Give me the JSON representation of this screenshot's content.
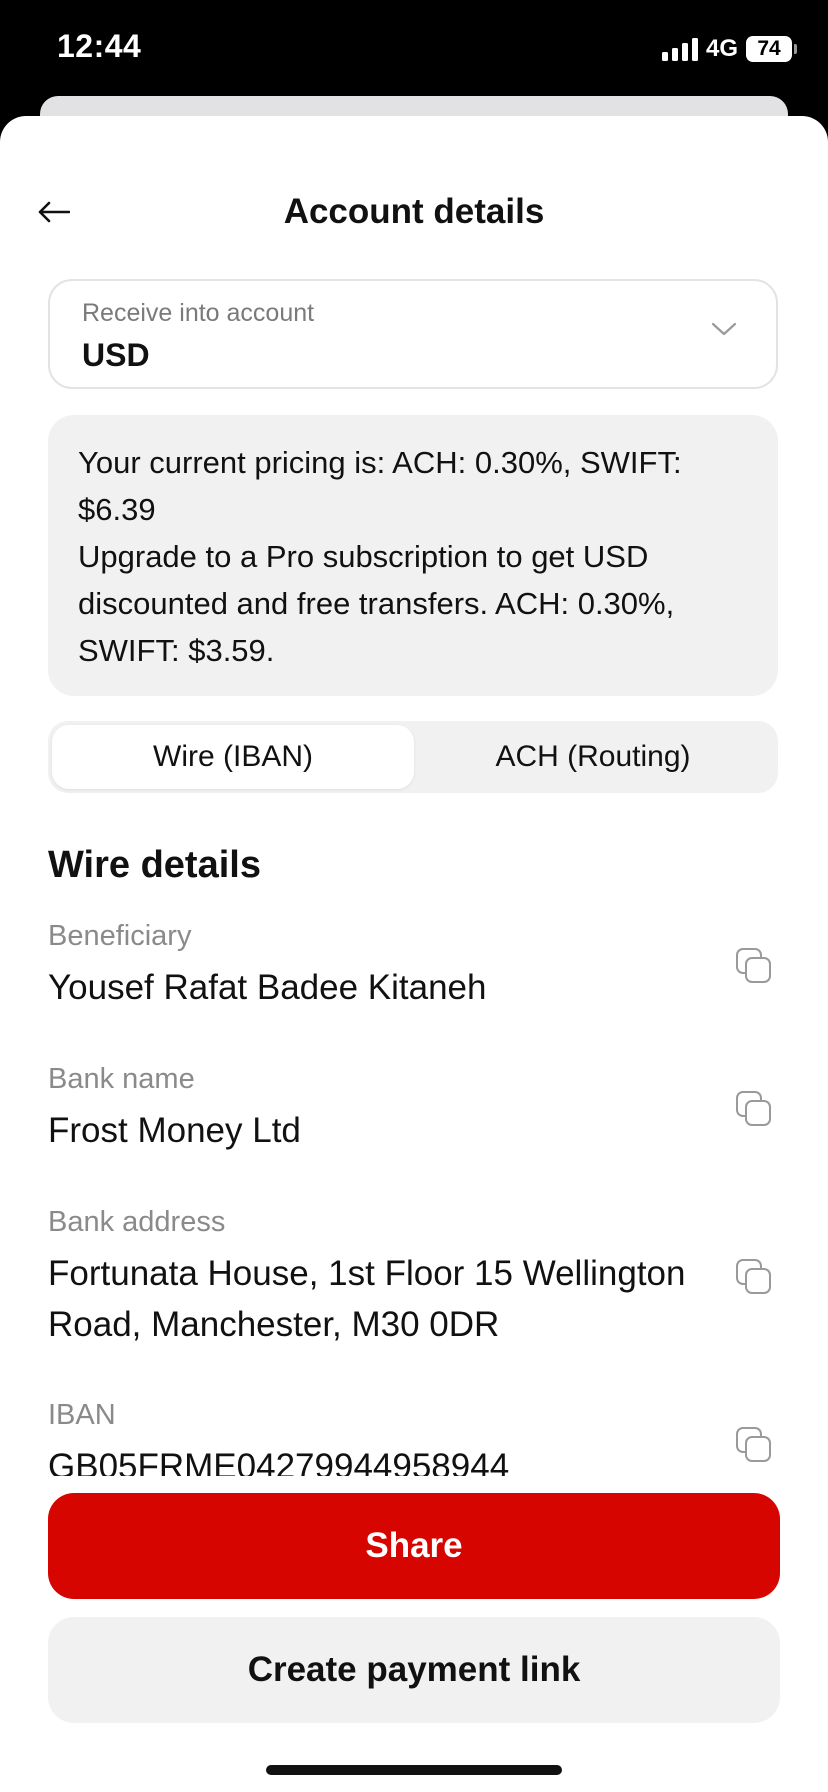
{
  "status_bar": {
    "time": "12:44",
    "network": "4G",
    "battery": "74"
  },
  "header": {
    "title": "Account details"
  },
  "account_select": {
    "label": "Receive into account",
    "value": "USD"
  },
  "pricing": {
    "line1": "Your current pricing is: ACH: 0.30%, SWIFT: $6.39",
    "line2": "Upgrade to a Pro subscription to get USD discounted and free transfers. ACH: 0.30%, SWIFT: $3.59."
  },
  "tabs": [
    {
      "label": "Wire (IBAN)",
      "active": true
    },
    {
      "label": "ACH (Routing)",
      "active": false
    }
  ],
  "section": {
    "title": "Wire details"
  },
  "details": [
    {
      "label": "Beneficiary",
      "value": "Yousef Rafat Badee Kitaneh"
    },
    {
      "label": "Bank name",
      "value": "Frost Money Ltd"
    },
    {
      "label": "Bank address",
      "value": "Fortunata House, 1st Floor 15 Wellington Road, Manchester, M30 0DR"
    },
    {
      "label": "IBAN",
      "value": "GB05FRME04279944958944"
    }
  ],
  "actions": {
    "share": "Share",
    "create_link": "Create payment link"
  },
  "colors": {
    "primary": "#d70500",
    "surface": "#f1f1f1",
    "muted_text": "#8a8a8a"
  }
}
